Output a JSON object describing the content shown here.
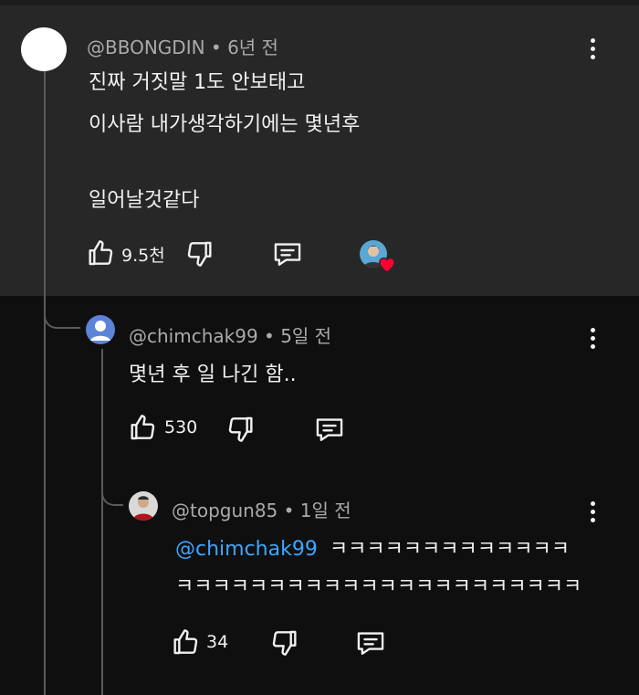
{
  "comments": [
    {
      "author": "@BBONGDIN",
      "time": "6년 전",
      "lines": [
        "진짜 거짓말 1도 안보태고",
        "이사람 내가생각하기에는 몇년후",
        "일어날것같다"
      ],
      "likes": "9.5천"
    },
    {
      "author": "@chimchak99",
      "time": "5일 전",
      "lines": [
        "몇년 후 일 나긴 함.."
      ],
      "likes": "530"
    },
    {
      "author": "@topgun85",
      "time": "1일 전",
      "mention": "@chimchak99",
      "lines": [
        "ㅋㅋㅋㅋㅋㅋㅋㅋㅋㅋㅋㅋㅋ",
        "ㅋㅋㅋㅋㅋㅋㅋㅋㅋㅋㅋㅋㅋㅋㅋㅋㅋㅋㅋㅋㅋㅋ"
      ],
      "likes": "34"
    }
  ],
  "icons": {
    "like": "thumbs-up-icon",
    "dislike": "thumbs-down-icon",
    "reply": "reply-icon",
    "menu": "more-vert-icon",
    "creator_heart": "creator-heart-icon"
  },
  "colors": {
    "background": "#0f0f0f",
    "highlight": "#272727",
    "text": "#f1f1f1",
    "meta": "#aaaaaa",
    "mention": "#3ea6ff",
    "heart": "#ff0033"
  }
}
